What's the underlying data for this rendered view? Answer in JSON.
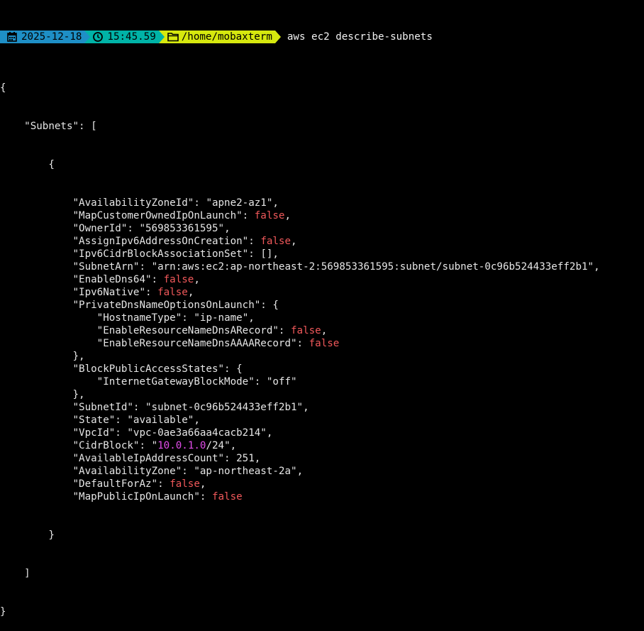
{
  "prompt": {
    "date": "2025-12-18",
    "time": "15:45.59",
    "path": "/home/mobaxterm",
    "command": "aws ec2 describe-subnets",
    "icons": [
      "calendar-icon",
      "clock-icon",
      "folder-icon"
    ]
  },
  "colors": {
    "date_segment": "#1e8fc6",
    "time_segment": "#00b3a7",
    "path_segment": "#d6e80e",
    "boolean": "#f0585a",
    "ip_highlight": "#e14ce9",
    "text": "#e6e6e6",
    "background": "#000000"
  },
  "output": {
    "open_brace": "{",
    "subnets_key": "\"Subnets\": [",
    "item_open": "{",
    "lines": [
      {
        "indent": 12,
        "key": "\"AvailabilityZoneId\"",
        "value": "\"apne2-az1\"",
        "type": "str",
        "comma": ","
      },
      {
        "indent": 12,
        "key": "\"MapCustomerOwnedIpOnLaunch\"",
        "value": "false",
        "type": "bool",
        "comma": ","
      },
      {
        "indent": 12,
        "key": "\"OwnerId\"",
        "value": "\"569853361595\"",
        "type": "str",
        "comma": ","
      },
      {
        "indent": 12,
        "key": "\"AssignIpv6AddressOnCreation\"",
        "value": "false",
        "type": "bool",
        "comma": ","
      },
      {
        "indent": 12,
        "key": "\"Ipv6CidrBlockAssociationSet\"",
        "value": "[]",
        "type": "str",
        "comma": ","
      },
      {
        "indent": 12,
        "key": "\"SubnetArn\"",
        "value": "\"arn:aws:ec2:ap-northeast-2:569853361595:subnet/subnet-0c96b524433eff2b1\"",
        "type": "str",
        "comma": ","
      },
      {
        "indent": 12,
        "key": "\"EnableDns64\"",
        "value": "false",
        "type": "bool",
        "comma": ","
      },
      {
        "indent": 12,
        "key": "\"Ipv6Native\"",
        "value": "false",
        "type": "bool",
        "comma": ","
      },
      {
        "indent": 12,
        "key": "\"PrivateDnsNameOptionsOnLaunch\"",
        "value": "{",
        "type": "str",
        "comma": ""
      },
      {
        "indent": 16,
        "key": "\"HostnameType\"",
        "value": "\"ip-name\"",
        "type": "str",
        "comma": ","
      },
      {
        "indent": 16,
        "key": "\"EnableResourceNameDnsARecord\"",
        "value": "false",
        "type": "bool",
        "comma": ","
      },
      {
        "indent": 16,
        "key": "\"EnableResourceNameDnsAAAARecord\"",
        "value": "false",
        "type": "bool",
        "comma": ""
      },
      {
        "indent": 12,
        "key": "",
        "value": "},",
        "type": "raw",
        "comma": ""
      },
      {
        "indent": 12,
        "key": "\"BlockPublicAccessStates\"",
        "value": "{",
        "type": "str",
        "comma": ""
      },
      {
        "indent": 16,
        "key": "\"InternetGatewayBlockMode\"",
        "value": "\"off\"",
        "type": "str",
        "comma": ""
      },
      {
        "indent": 12,
        "key": "",
        "value": "},",
        "type": "raw",
        "comma": ""
      },
      {
        "indent": 12,
        "key": "\"SubnetId\"",
        "value": "\"subnet-0c96b524433eff2b1\"",
        "type": "str",
        "comma": ","
      },
      {
        "indent": 12,
        "key": "\"State\"",
        "value": "\"available\"",
        "type": "str",
        "comma": ","
      },
      {
        "indent": 12,
        "key": "\"VpcId\"",
        "value": "\"vpc-0ae3a66aa4cacb214\"",
        "type": "str",
        "comma": ","
      },
      {
        "indent": 12,
        "key": "\"CidrBlock\"",
        "value": "10.0.1.0",
        "type": "cidr",
        "suffix": "/24\"",
        "comma": ","
      },
      {
        "indent": 12,
        "key": "\"AvailableIpAddressCount\"",
        "value": "251",
        "type": "str",
        "comma": ","
      },
      {
        "indent": 12,
        "key": "\"AvailabilityZone\"",
        "value": "\"ap-northeast-2a\"",
        "type": "str",
        "comma": ","
      },
      {
        "indent": 12,
        "key": "\"DefaultForAz\"",
        "value": "false",
        "type": "bool",
        "comma": ","
      },
      {
        "indent": 12,
        "key": "\"MapPublicIpOnLaunch\"",
        "value": "false",
        "type": "bool",
        "comma": ""
      }
    ],
    "item_close": "}",
    "array_close": "]",
    "close_brace": "}"
  }
}
